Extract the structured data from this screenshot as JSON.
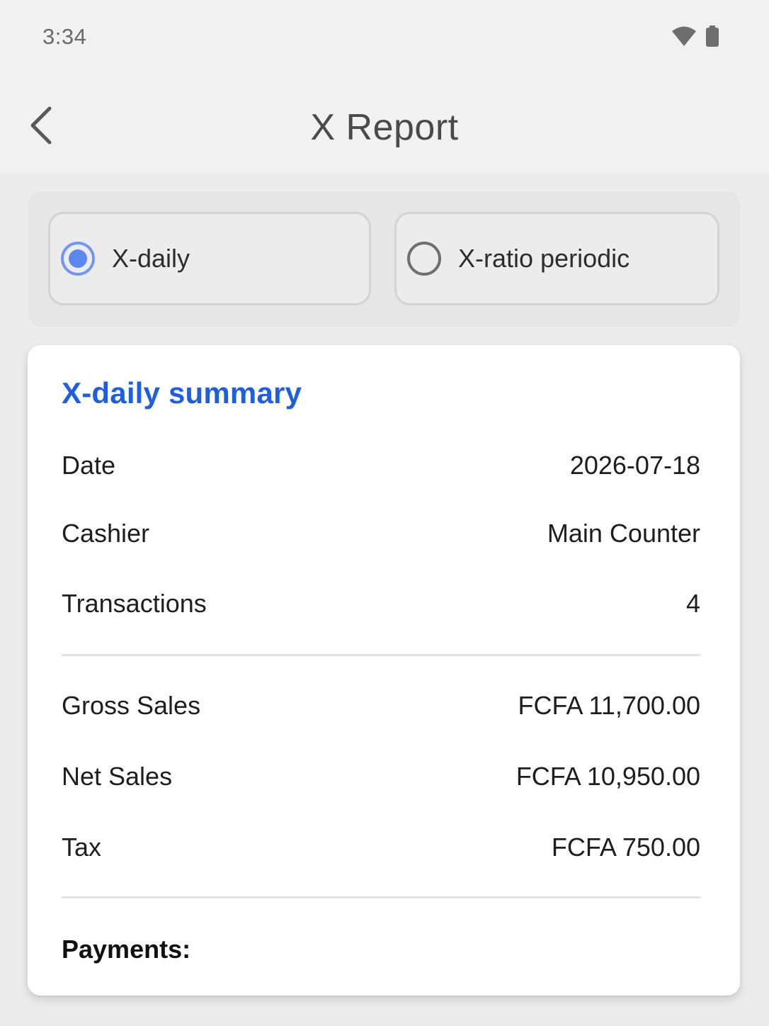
{
  "status_bar": {
    "time": "3:34",
    "icons": [
      "wifi-icon",
      "battery-icon"
    ]
  },
  "app_bar": {
    "back_icon": "chevron-left-icon",
    "title": "X Report"
  },
  "report_modes": {
    "options": [
      {
        "label": "X-daily",
        "selected": true
      },
      {
        "label": "X-ratio periodic",
        "selected": false
      }
    ]
  },
  "summary": {
    "title": "X-daily summary",
    "rows": [
      {
        "label": "Date",
        "value": "2026-07-18"
      },
      {
        "label": "Cashier",
        "value": "Main Counter"
      },
      {
        "label": "Transactions",
        "value": "4"
      },
      {
        "label": "Gross Sales",
        "value": "FCFA 11,700.00"
      },
      {
        "label": "Net Sales",
        "value": "FCFA 10,950.00"
      },
      {
        "label": "Tax",
        "value": "FCFA 750.00"
      }
    ],
    "payments_label": "Payments:"
  },
  "colors": {
    "accent": "#1e5fe0",
    "radio_selected": "#5c87ec",
    "background": "#ececec",
    "card": "#ffffff"
  }
}
